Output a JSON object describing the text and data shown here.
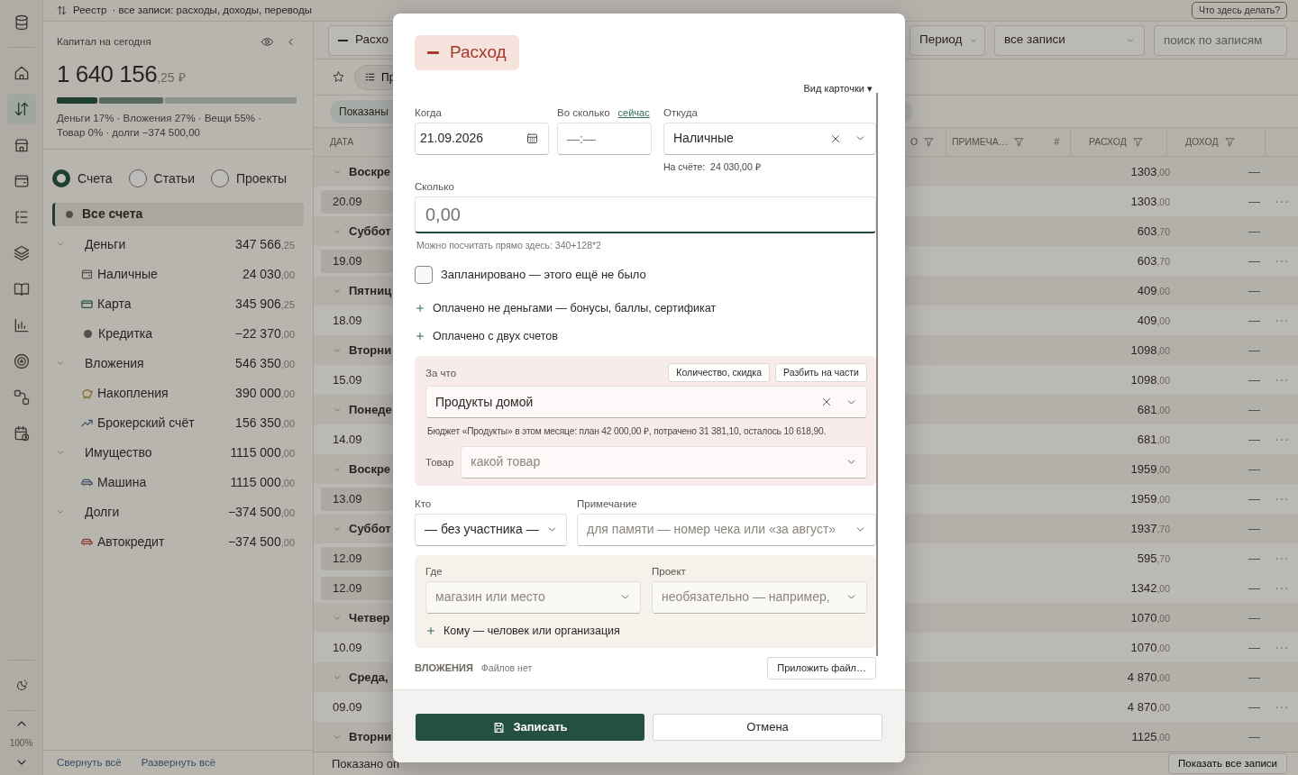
{
  "top_bar": {
    "title": "Реестр",
    "subtitle": "· все записи: расходы, доходы, переводы",
    "help_button": "Что здесь делать?"
  },
  "rail": {
    "items": [
      {
        "kind": "database",
        "selected": false
      },
      {
        "kind": "home",
        "selected": false
      },
      {
        "kind": "transfers",
        "selected": true
      },
      {
        "kind": "store",
        "selected": false
      },
      {
        "kind": "wallet",
        "selected": false
      },
      {
        "kind": "tree",
        "selected": false
      },
      {
        "kind": "layers",
        "selected": false
      },
      {
        "kind": "book",
        "selected": false
      },
      {
        "kind": "chart",
        "selected": false
      },
      {
        "kind": "target",
        "selected": false
      },
      {
        "kind": "nodes",
        "selected": false
      },
      {
        "kind": "schedule",
        "selected": false
      }
    ],
    "zoom": "100%"
  },
  "capital": {
    "title": "Капитал на сегодня",
    "amount": "1 640 156,25 ₽",
    "segments": [
      {
        "level": 0.17
      },
      {
        "level": 0.27
      },
      {
        "level": 0.55
      }
    ],
    "caption": "Деньги 17% · Вложения 27% · Вещи 55% · Товар 0% · долги −374 500,00"
  },
  "view_tabs": [
    {
      "label": "Счета",
      "selected": true
    },
    {
      "label": "Статьи",
      "selected": false
    },
    {
      "label": "Проекты",
      "selected": false
    }
  ],
  "accounts": {
    "all": {
      "label": "Все счета",
      "selected": true
    },
    "groups": [
      {
        "label": "Деньги",
        "amount": "347 566,25",
        "expanded": true,
        "children": [
          {
            "label": "Наличные",
            "amount": "24 030,00",
            "kind": "wallet"
          },
          {
            "label": "Карта",
            "amount": "345 906,25",
            "kind": "card"
          },
          {
            "label": "Кредитка",
            "amount": "−22 370,00",
            "kind": "dot"
          }
        ]
      },
      {
        "label": "Вложения",
        "amount": "546 350,00",
        "expanded": true,
        "children": [
          {
            "label": "Накопления",
            "amount": "390 000,00",
            "kind": "piggy"
          },
          {
            "label": "Брокерский счёт",
            "amount": "156 350,00",
            "kind": "trend"
          }
        ]
      },
      {
        "label": "Имущество",
        "amount": "1115 000,00",
        "expanded": true,
        "children": [
          {
            "label": "Машина",
            "amount": "1115 000,00",
            "kind": "car"
          }
        ]
      },
      {
        "label": "Долги",
        "amount": "−374 500,00",
        "expanded": true,
        "children": [
          {
            "label": "Автокредит",
            "amount": "−374 500,00",
            "kind": "loan"
          }
        ]
      }
    ]
  },
  "panel_footer": [
    "Свернуть всё",
    "Развернуть всё"
  ],
  "toolbar": {
    "type_button": "Расхо",
    "period": "Период",
    "filter": "все записи",
    "search_placeholder": "поиск по записям"
  },
  "preset_chip": "Пр",
  "shown_chip": "Показаны",
  "table": {
    "columns": [
      {
        "label": "ДАТА",
        "filter": false
      },
      {
        "label": "О",
        "filter": true
      },
      {
        "label": "ПРИМЕЧА…",
        "filter": true
      },
      {
        "label": "#",
        "filter": false
      },
      {
        "label": "РАСХОД",
        "filter": true
      },
      {
        "label": "ДОХОД",
        "filter": true
      }
    ],
    "rows": [
      {
        "kind": "day",
        "label": "Воскре",
        "expanded": true,
        "expense": "1303,00",
        "income": "—"
      },
      {
        "kind": "entry",
        "date": "20.09",
        "highlighted": true,
        "expense": "1303,00",
        "income": "—"
      },
      {
        "kind": "day",
        "label": "Суббот",
        "expanded": true,
        "expense": "603,70",
        "income": "—"
      },
      {
        "kind": "entry",
        "date": "19.09",
        "highlighted": true,
        "expense": "603,70",
        "income": "—"
      },
      {
        "kind": "day",
        "label": "Пятниц",
        "expanded": true,
        "expense": "409,00",
        "income": "—"
      },
      {
        "kind": "entry",
        "date": "18.09",
        "highlighted": false,
        "expense": "409,00",
        "income": "—"
      },
      {
        "kind": "day",
        "label": "Вторни",
        "expanded": true,
        "expense": "1098,00",
        "income": "—"
      },
      {
        "kind": "entry",
        "date": "15.09",
        "highlighted": false,
        "expense": "1098,00",
        "income": "—"
      },
      {
        "kind": "day",
        "label": "Понеде",
        "expanded": true,
        "expense": "681,00",
        "income": "—"
      },
      {
        "kind": "entry",
        "date": "14.09",
        "highlighted": false,
        "expense": "681,00",
        "income": "—"
      },
      {
        "kind": "day",
        "label": "Воскре",
        "expanded": true,
        "expense": "1959,00",
        "income": "—"
      },
      {
        "kind": "entry",
        "date": "13.09",
        "highlighted": true,
        "expense": "1959,00",
        "income": "—"
      },
      {
        "kind": "day",
        "label": "Суббот",
        "expanded": true,
        "expense": "1937,70",
        "income": "—"
      },
      {
        "kind": "entry",
        "date": "12.09",
        "highlighted": true,
        "expense": "595,70",
        "income": "—"
      },
      {
        "kind": "entry",
        "date": "12.09",
        "highlighted": true,
        "expense": "1342,00",
        "income": "—"
      },
      {
        "kind": "day",
        "label": "Четвер",
        "expanded": true,
        "expense": "1070,00",
        "income": "—"
      },
      {
        "kind": "entry",
        "date": "10.09",
        "highlighted": false,
        "expense": "1070,00",
        "income": "—"
      },
      {
        "kind": "day",
        "label": "Среда,",
        "expanded": true,
        "expense": "4 870,00",
        "income": "—"
      },
      {
        "kind": "entry",
        "date": "09.09",
        "highlighted": false,
        "expense": "4 870,00",
        "income": "—"
      },
      {
        "kind": "day",
        "label": "Вторни",
        "expanded": true,
        "expense": "1125,00",
        "income": "—"
      }
    ]
  },
  "table_footer": {
    "summary": "Показано оп",
    "show_all": "Показать все записи"
  },
  "modal": {
    "type_button": "Расход",
    "card_view": "Вид карточки ▾",
    "when": {
      "label": "Когда",
      "value": "21.09.2026"
    },
    "time": {
      "label": "Во сколько",
      "link": "сейчас",
      "placeholder": "—:—"
    },
    "from": {
      "label": "Откуда",
      "value": "Наличные",
      "balance": "На счёте:  24 030,00 ₽"
    },
    "amount": {
      "label": "Сколько",
      "placeholder": "0,00",
      "hint": "Можно посчитать прямо здесь: 340+128*2"
    },
    "planned": {
      "label": "Запланировано — этого ещё не было",
      "checked": false
    },
    "options": [
      "Оплачено не деньгами — бонусы, баллы, сертификат",
      "Оплачено с двух счетов"
    ],
    "category": {
      "label": "За что",
      "buttons": [
        "Количество, скидка",
        "Разбить на части"
      ],
      "value": "Продукты домой",
      "budget": "Бюджет «Продукты» в этом месяце: план 42 000,00 ₽, потрачено 31 381,10, осталось 10 618,90.",
      "item_label": "Товар",
      "item_placeholder": "какой товар"
    },
    "who": {
      "label": "Кто",
      "value": "— без участника —"
    },
    "note": {
      "label": "Примечание",
      "placeholder": "для памяти — номер чека или «за август»"
    },
    "place": {
      "label": "Где",
      "placeholder": "магазин или место"
    },
    "project": {
      "label": "Проект",
      "placeholder": "необязательно — например,"
    },
    "payee_option": "Кому — человек или организация",
    "attachments": {
      "label": "ВЛОЖЕНИЯ",
      "status": "Файлов нет",
      "button": "Приложить файл…"
    },
    "save_button": "Записать",
    "cancel_button": "Отмена"
  }
}
